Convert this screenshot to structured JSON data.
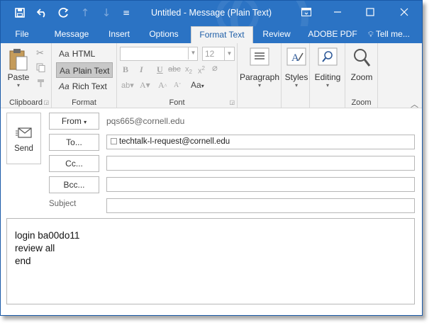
{
  "window": {
    "title": "Untitled - Message (Plain Text)",
    "controls": {
      "ribbon_options_icon": "ribbon-display-icon",
      "minimize_icon": "minimize-icon",
      "maximize_icon": "maximize-icon",
      "close_icon": "close-icon"
    }
  },
  "quick_access": {
    "save_icon": "save-icon",
    "undo_icon": "undo-icon",
    "redo_icon": "redo-icon",
    "up_icon": "arrow-up-icon",
    "down_icon": "arrow-down-icon",
    "customize_icon": "customize-icon"
  },
  "tabs": [
    {
      "label": "File"
    },
    {
      "label": "Message"
    },
    {
      "label": "Insert"
    },
    {
      "label": "Options"
    },
    {
      "label": "Format Text",
      "active": true
    },
    {
      "label": "Review"
    },
    {
      "label": "ADOBE PDF"
    },
    {
      "label": "Tell me..."
    }
  ],
  "ribbon": {
    "clipboard": {
      "label": "Clipboard",
      "paste": "Paste"
    },
    "format": {
      "label": "Format",
      "html": "HTML",
      "plain": "Plain Text",
      "rich": "Rich Text",
      "aa": "Aa",
      "selected": "Plain Text"
    },
    "font": {
      "label": "Font",
      "font_name": "",
      "font_size": "12",
      "aa_label": "Aa"
    },
    "paragraph": {
      "label": "Paragraph"
    },
    "styles": {
      "label": "Styles"
    },
    "editing": {
      "label": "Editing"
    },
    "zoom": {
      "label": "Zoom",
      "zoom_label": "Zoom"
    }
  },
  "compose": {
    "send": "Send",
    "from_label": "From",
    "from_value": "pqs665@cornell.edu",
    "to_label": "To...",
    "to_value": "techtalk-l-request@cornell.edu",
    "cc_label": "Cc...",
    "bcc_label": "Bcc...",
    "subject_label": "Subject",
    "subject_value": "",
    "body_lines": [
      "login ba00do11",
      "review all",
      "end"
    ]
  },
  "colors": {
    "titlebar": "#2b73c4",
    "ribbon": "#f3f3f3",
    "active_tab_text": "#1f5fa8"
  }
}
